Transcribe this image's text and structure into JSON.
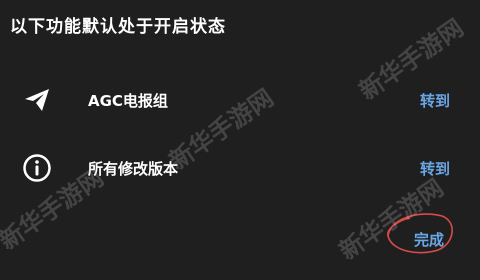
{
  "dialog": {
    "title": "以下功能默认处于开启状态",
    "items": [
      {
        "label": "AGC电报组",
        "action": "转到",
        "icon": "telegram-send-icon"
      },
      {
        "label": "所有修改版本",
        "action": "转到",
        "icon": "info-icon"
      }
    ],
    "done_label": "完成"
  },
  "watermark": {
    "text": "新华手游网"
  },
  "colors": {
    "background": "#1f1f1f",
    "text": "#ffffff",
    "accent": "#6aa7e6",
    "scribble": "#d94a4a"
  }
}
